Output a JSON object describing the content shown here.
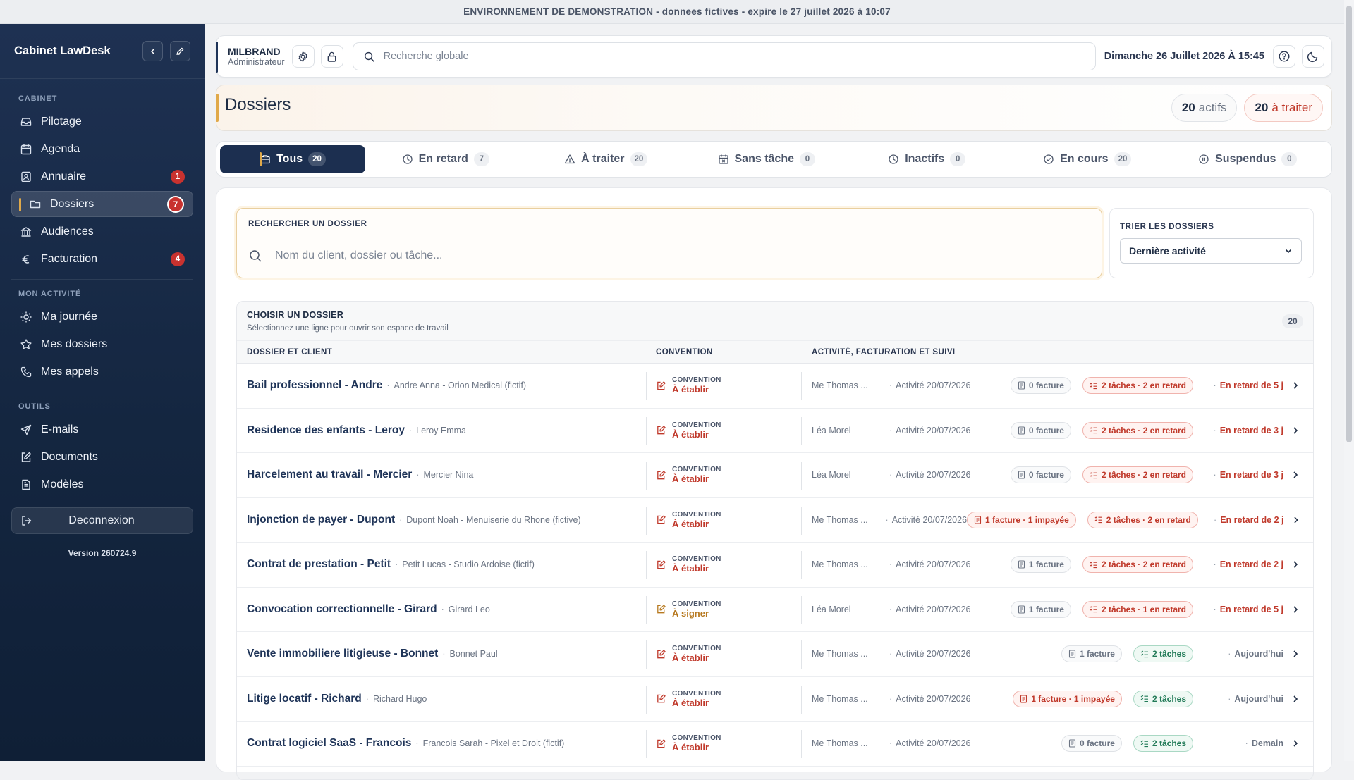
{
  "banner": "ENVIRONNEMENT DE DEMONSTRATION - donnees fictives - expire le 27 juillet 2026 à 10:07",
  "sidebar": {
    "title": "Cabinet LawDesk",
    "sections": {
      "cabinet": "CABINET",
      "activity": "MON ACTIVITÉ",
      "tools": "OUTILS"
    },
    "items": [
      {
        "label": "Pilotage",
        "icon": "inbox-icon"
      },
      {
        "label": "Agenda",
        "icon": "calendar-icon"
      },
      {
        "label": "Annuaire",
        "icon": "contacts-icon",
        "badge": "1"
      },
      {
        "label": "Dossiers",
        "icon": "folder-icon",
        "badge": "7",
        "active": true
      },
      {
        "label": "Audiences",
        "icon": "courthouse-icon"
      },
      {
        "label": "Facturation",
        "icon": "euro-icon",
        "badge": "4"
      },
      {
        "label": "Ma journée",
        "icon": "sun-icon"
      },
      {
        "label": "Mes dossiers",
        "icon": "star-icon"
      },
      {
        "label": "Mes appels",
        "icon": "phone-icon"
      },
      {
        "label": "E-mails",
        "icon": "send-icon"
      },
      {
        "label": "Documents",
        "icon": "document-edit-icon"
      },
      {
        "label": "Modèles",
        "icon": "template-icon"
      }
    ],
    "logout": "Deconnexion",
    "version_label": "Version",
    "version_number": "260724.9"
  },
  "topbar": {
    "user_name": "MILBRAND",
    "user_role": "Administrateur",
    "search_placeholder": "Recherche globale",
    "date": "Dimanche 26 Juillet 2026 À 15:45"
  },
  "header": {
    "title": "Dossiers",
    "active_count": "20",
    "active_label": "actifs",
    "todo_count": "20",
    "todo_label": "à traiter"
  },
  "tabs": [
    {
      "label": "Tous",
      "count": "20",
      "icon": "briefcase-icon",
      "active": true
    },
    {
      "label": "En retard",
      "count": "7",
      "icon": "clock-icon"
    },
    {
      "label": "À traiter",
      "count": "20",
      "icon": "warning-icon"
    },
    {
      "label": "Sans tâche",
      "count": "0",
      "icon": "calendar-x-icon"
    },
    {
      "label": "Inactifs",
      "count": "0",
      "icon": "clock-icon"
    },
    {
      "label": "En cours",
      "count": "20",
      "icon": "check-circle-icon"
    },
    {
      "label": "Suspendus",
      "count": "0",
      "icon": "pause-circle-icon"
    }
  ],
  "search": {
    "label": "RECHERCHER UN DOSSIER",
    "placeholder": "Nom du client, dossier ou tâche..."
  },
  "sort": {
    "label": "TRIER LES DOSSIERS",
    "selected": "Dernière activité"
  },
  "list": {
    "title": "CHOISIR UN DOSSIER",
    "subtitle": "Sélectionnez une ligne pour ouvrir son espace de travail",
    "count": "20",
    "columns": [
      "DOSSIER ET CLIENT",
      "CONVENTION",
      "ACTIVITÉ, FACTURATION ET SUIVI"
    ],
    "convention_key": "CONVENTION",
    "rows": [
      {
        "title": "Bail professionnel - Andre",
        "client": "Andre Anna - Orion Medical (fictif)",
        "conv": "À établir",
        "conv_color": "#c0392b",
        "owner": "Me Thomas ...",
        "activity": "Activité 20/07/2026",
        "invoice": "0 facture",
        "invoice_red": false,
        "tasks": "2 tâches · 2 en retard",
        "tasks_state": "red",
        "status": "En retard de 5 j",
        "status_color": "#c0392b"
      },
      {
        "title": "Residence des enfants - Leroy",
        "client": "Leroy Emma",
        "conv": "À établir",
        "conv_color": "#c0392b",
        "owner": "Léa Morel",
        "activity": "Activité 20/07/2026",
        "invoice": "0 facture",
        "invoice_red": false,
        "tasks": "2 tâches · 2 en retard",
        "tasks_state": "red",
        "status": "En retard de 3 j",
        "status_color": "#c0392b"
      },
      {
        "title": "Harcelement au travail - Mercier",
        "client": "Mercier Nina",
        "conv": "À établir",
        "conv_color": "#c0392b",
        "owner": "Léa Morel",
        "activity": "Activité 20/07/2026",
        "invoice": "0 facture",
        "invoice_red": false,
        "tasks": "2 tâches · 2 en retard",
        "tasks_state": "red",
        "status": "En retard de 3 j",
        "status_color": "#c0392b"
      },
      {
        "title": "Injonction de payer - Dupont",
        "client": "Dupont Noah - Menuiserie du Rhone (fictive)",
        "conv": "À établir",
        "conv_color": "#c0392b",
        "owner": "Me Thomas ...",
        "activity": "Activité 20/07/2026",
        "invoice": "1 facture · 1 impayée",
        "invoice_red": true,
        "tasks": "2 tâches · 2 en retard",
        "tasks_state": "red",
        "status": "En retard de 2 j",
        "status_color": "#c0392b"
      },
      {
        "title": "Contrat de prestation - Petit",
        "client": "Petit Lucas - Studio Ardoise (fictif)",
        "conv": "À établir",
        "conv_color": "#c0392b",
        "owner": "Me Thomas ...",
        "activity": "Activité 20/07/2026",
        "invoice": "1 facture",
        "invoice_red": false,
        "tasks": "2 tâches · 2 en retard",
        "tasks_state": "red",
        "status": "En retard de 2 j",
        "status_color": "#c0392b"
      },
      {
        "title": "Convocation correctionnelle - Girard",
        "client": "Girard Leo",
        "conv": "À signer",
        "conv_color": "#b7791f",
        "owner": "Léa Morel",
        "activity": "Activité 20/07/2026",
        "invoice": "1 facture",
        "invoice_red": false,
        "tasks": "2 tâches · 1 en retard",
        "tasks_state": "red",
        "status": "En retard de 5 j",
        "status_color": "#c0392b"
      },
      {
        "title": "Vente immobiliere litigieuse - Bonnet",
        "client": "Bonnet Paul",
        "conv": "À établir",
        "conv_color": "#c0392b",
        "owner": "Me Thomas ...",
        "activity": "Activité 20/07/2026",
        "invoice": "1 facture",
        "invoice_red": false,
        "tasks": "2 tâches",
        "tasks_state": "green",
        "status": "Aujourd'hui",
        "status_color": "#6b7483"
      },
      {
        "title": "Litige locatif - Richard",
        "client": "Richard Hugo",
        "conv": "À établir",
        "conv_color": "#c0392b",
        "owner": "Me Thomas ...",
        "activity": "Activité 20/07/2026",
        "invoice": "1 facture · 1 impayée",
        "invoice_red": true,
        "tasks": "2 tâches",
        "tasks_state": "green",
        "status": "Aujourd'hui",
        "status_color": "#6b7483"
      },
      {
        "title": "Contrat logiciel SaaS - Francois",
        "client": "Francois Sarah - Pixel et Droit (fictif)",
        "conv": "À établir",
        "conv_color": "#c0392b",
        "owner": "Me Thomas ...",
        "activity": "Activité 20/07/2026",
        "invoice": "0 facture",
        "invoice_red": false,
        "tasks": "2 tâches",
        "tasks_state": "green",
        "status": "Demain",
        "status_color": "#6b7483"
      }
    ]
  }
}
